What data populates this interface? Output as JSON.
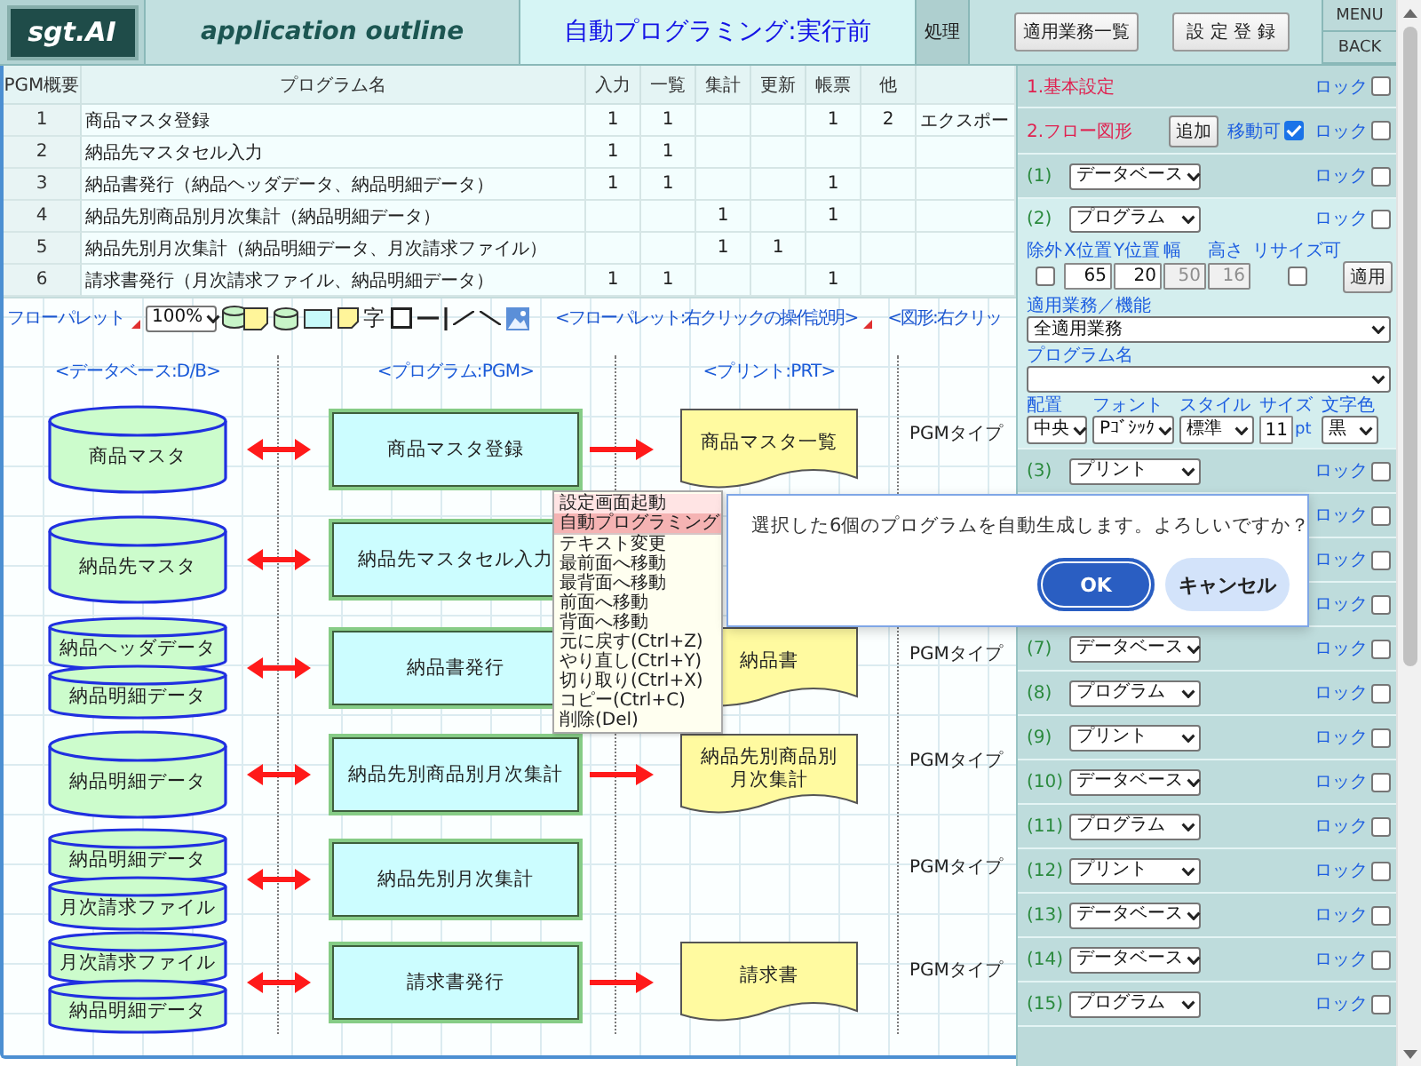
{
  "header": {
    "logo": "sgt.AI",
    "app_title": "application outline",
    "page_title": "自動プログラミング:実行前",
    "process_label": "処理",
    "buttons": [
      "適用業務一覧",
      "設 定 登 録"
    ],
    "nav_buttons": [
      "MENU",
      "BACK"
    ]
  },
  "program_table": {
    "columns": [
      "PGM概要",
      "プログラム名",
      "入力",
      "一覧",
      "集計",
      "更新",
      "帳票",
      "他"
    ],
    "rows": [
      {
        "no": "1",
        "name": "商品マスタ登録",
        "input": "1",
        "list": "1",
        "report": "1",
        "other": "2",
        "column_9": "エクスポー"
      },
      {
        "no": "2",
        "name": "納品先マスタセル入力",
        "input": "1",
        "list": "1"
      },
      {
        "no": "3",
        "name": "納品書発行（納品ヘッダデータ、納品明細データ）",
        "input": "1",
        "list": "1",
        "report": "1"
      },
      {
        "no": "4",
        "name": "納品先別商品別月次集計（納品明細データ）",
        "aggregate": "1",
        "report": "1"
      },
      {
        "no": "5",
        "name": "納品先別月次集計（納品明細データ、月次請求ファイル）",
        "aggregate": "1",
        "update": "1"
      },
      {
        "no": "6",
        "name": "請求書発行（月次請求ファイル、納品明細データ）",
        "input": "1",
        "list": "1",
        "report": "1"
      }
    ]
  },
  "toolbar": {
    "palette": {
      "label": "フローパレット",
      "menu_mark": true
    },
    "zoom": "100%",
    "tools": [
      {
        "kind": "dbnote"
      },
      {
        "kind": "database"
      },
      {
        "kind": "rectangle"
      },
      {
        "kind": "note"
      },
      {
        "kind": "text",
        "label": "字"
      },
      {
        "kind": "square"
      },
      {
        "kind": "hline"
      },
      {
        "kind": "vline"
      },
      {
        "kind": "slash"
      },
      {
        "kind": "backslash"
      },
      {
        "kind": "image"
      }
    ],
    "help_links": [
      {
        "text": "<フローパレット:右クリックの操作説明>",
        "menu_mark": true
      },
      {
        "text": "<図形:右クリッ",
        "menu_mark": false
      }
    ]
  },
  "diagram": {
    "column_headers": [
      "<データベース:D/B>",
      "<プログラム:PGM>",
      "<プリント:PRT>"
    ],
    "rows": [
      {
        "databases": [
          "商品マスタ"
        ],
        "program": "商品マスタ登録",
        "output_arrow": true,
        "print": "商品マスタ一覧",
        "pgm_type": "PGMタイプ"
      },
      {
        "databases": [
          "納品先マスタ"
        ],
        "program": "納品先マスタセル入力"
      },
      {
        "databases": [
          "納品ヘッダデータ",
          "納品明細データ"
        ],
        "program": "納品書発行",
        "output_arrow": false,
        "print": "納品書",
        "pgm_type": "PGMタイプ"
      },
      {
        "databases": [
          "納品明細データ"
        ],
        "program": "納品先別商品別月次集計",
        "output_arrow": true,
        "print": "納品先別商品別月次集計",
        "pgm_type": "PGMタイプ"
      },
      {
        "databases": [
          "納品明細データ",
          "月次請求ファイル"
        ],
        "program": "納品先別月次集計",
        "pgm_type": "PGMタイプ"
      },
      {
        "databases": [
          "月次請求ファイル",
          "納品明細データ"
        ],
        "program": "請求書発行",
        "output_arrow": true,
        "print": "請求書",
        "pgm_type": "PGMタイプ"
      }
    ]
  },
  "context_menu": {
    "items": [
      {
        "kind": "command",
        "label": "設定画面起動",
        "default": true,
        "selected": false
      },
      {
        "kind": "command",
        "label": "自動プログラミング",
        "default": false,
        "selected": true
      },
      {
        "kind": "separator"
      },
      {
        "kind": "command",
        "label": "テキスト変更",
        "default": false,
        "selected": false
      },
      {
        "kind": "command",
        "label": "最前面へ移動",
        "default": false,
        "selected": false
      },
      {
        "kind": "command",
        "label": "最背面へ移動",
        "default": false,
        "selected": false
      },
      {
        "kind": "command",
        "label": "前面へ移動",
        "default": false,
        "selected": false
      },
      {
        "kind": "command",
        "label": "背面へ移動",
        "default": false,
        "selected": false
      },
      {
        "kind": "command",
        "label": "元に戻す(Ctrl+Z)",
        "default": false,
        "selected": false
      },
      {
        "kind": "command",
        "label": "やり直し(Ctrl+Y)",
        "default": false,
        "selected": false
      },
      {
        "kind": "command",
        "label": "切り取り(Ctrl+X)",
        "default": false,
        "selected": false
      },
      {
        "kind": "command",
        "label": "コピー(Ctrl+C)",
        "default": false,
        "selected": false
      },
      {
        "kind": "command",
        "label": "削除(Del)",
        "default": false,
        "selected": false
      }
    ]
  },
  "dialog": {
    "message": "選択した6個のプログラムを自動生成します。よろしいですか？",
    "buttons": [
      {
        "kind": "primary",
        "label": "OK"
      },
      {
        "kind": "secondary",
        "label": "キャンセル"
      }
    ]
  },
  "settings_panel": {
    "sections": [
      {
        "title": "1.基本設定",
        "lock_label": "ロック",
        "locked": false
      },
      {
        "title": "2.フロー図形",
        "add_button": "追加",
        "movable_label": "移動可",
        "movable": true,
        "lock_label": "ロック",
        "locked": false
      }
    ],
    "shapes": [
      {
        "number": "(1)",
        "type": "データベース",
        "expanded": false,
        "lock_label": "ロック",
        "locked": false
      },
      {
        "number": "(2)",
        "type": "プログラム",
        "expanded": true,
        "lock_label": "ロック",
        "locked": false,
        "editor": {
          "fields": [
            {
              "kind": "checkbox",
              "label": "除外",
              "checked": false
            },
            {
              "kind": "number",
              "label": "X位置",
              "value": "65",
              "disabled": false
            },
            {
              "kind": "number",
              "label": "Y位置",
              "value": "20",
              "disabled": false
            },
            {
              "kind": "number",
              "label": "幅",
              "value": "50",
              "disabled": true
            },
            {
              "kind": "number",
              "label": "高さ",
              "value": "16",
              "disabled": true
            },
            {
              "kind": "checkbox",
              "label": "リサイズ可",
              "checked": false
            }
          ],
          "apply_button": "適用",
          "business": {
            "label": "適用業務／機能",
            "value": "全適用業務"
          },
          "program_name": {
            "label": "プログラム名"
          },
          "format": [
            {
              "kind": "select",
              "label": "配置",
              "value": "中央"
            },
            {
              "kind": "select",
              "label": "フォント",
              "value": "Pｺﾞｼｯｸ"
            },
            {
              "kind": "select",
              "label": "スタイル",
              "value": "標準"
            },
            {
              "kind": "number",
              "label": "サイズ",
              "value": "11",
              "unit": "pt"
            },
            {
              "kind": "select",
              "label": "文字色",
              "value": "黒"
            }
          ]
        }
      },
      {
        "number": "(3)",
        "type": "プリント",
        "expanded": false,
        "lock_label": "ロック",
        "locked": false
      },
      {
        "expanded": false,
        "lock_label": "ロック",
        "locked": false
      },
      {
        "expanded": false,
        "lock_label": "ロック",
        "locked": false
      },
      {
        "expanded": false,
        "lock_label": "ロック",
        "locked": false
      },
      {
        "number": "(7)",
        "type": "データベース",
        "expanded": false,
        "lock_label": "ロック",
        "locked": false
      },
      {
        "number": "(8)",
        "type": "プログラム",
        "expanded": false,
        "lock_label": "ロック",
        "locked": false
      },
      {
        "number": "(9)",
        "type": "プリント",
        "expanded": false,
        "lock_label": "ロック",
        "locked": false
      },
      {
        "number": "(10)",
        "type": "データベース",
        "expanded": false,
        "lock_label": "ロック",
        "locked": false
      },
      {
        "number": "(11)",
        "type": "プログラム",
        "expanded": false,
        "lock_label": "ロック",
        "locked": false
      },
      {
        "number": "(12)",
        "type": "プリント",
        "expanded": false,
        "lock_label": "ロック",
        "locked": false
      },
      {
        "number": "(13)",
        "type": "データベース",
        "expanded": false,
        "lock_label": "ロック",
        "locked": false
      },
      {
        "number": "(14)",
        "type": "データベース",
        "expanded": false,
        "lock_label": "ロック",
        "locked": false
      },
      {
        "number": "(15)",
        "type": "プログラム",
        "expanded": false,
        "lock_label": "ロック",
        "locked": false
      }
    ]
  }
}
